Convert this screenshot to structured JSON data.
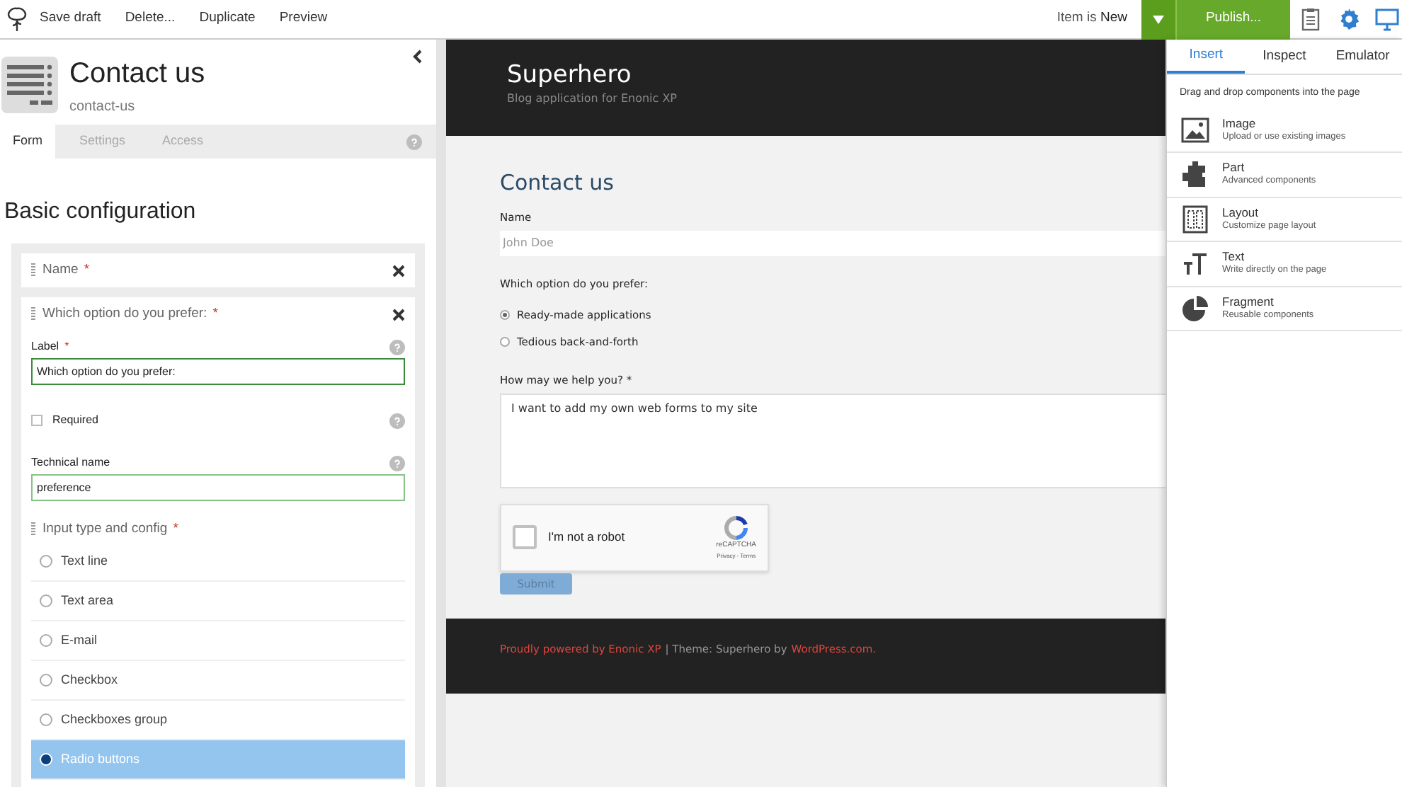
{
  "toolbar": {
    "actions": [
      "Save draft",
      "Delete...",
      "Duplicate",
      "Preview"
    ],
    "status_prefix": "Item is",
    "status": "New",
    "publish": "Publish..."
  },
  "editor": {
    "title": "Contact us",
    "path": "contact-us",
    "tabs": [
      {
        "label": "Form",
        "selected": true
      },
      {
        "label": "Settings",
        "selected": false
      },
      {
        "label": "Access",
        "selected": false
      }
    ],
    "section_title": "Basic configuration",
    "items": [
      {
        "title": "Name",
        "required": "*",
        "expanded": false
      },
      {
        "title": "Which option do you prefer:",
        "required": "*",
        "expanded": true,
        "label_field": {
          "label": "Label",
          "required": "*",
          "value": "Which option do you prefer:"
        },
        "required_option": {
          "label": "Required",
          "checked": false
        },
        "technical_field": {
          "label": "Technical name",
          "value": "preference"
        },
        "input_type": {
          "title": "Input type and config",
          "required": "*",
          "options": [
            {
              "label": "Text line",
              "selected": false
            },
            {
              "label": "Text area",
              "selected": false
            },
            {
              "label": "E-mail",
              "selected": false
            },
            {
              "label": "Checkbox",
              "selected": false
            },
            {
              "label": "Checkboxes group",
              "selected": false
            },
            {
              "label": "Radio buttons",
              "selected": true
            }
          ]
        }
      }
    ]
  },
  "preview": {
    "site_title": "Superhero",
    "tagline": "Blog application for Enonic XP",
    "form": {
      "title": "Contact us",
      "name_label": "Name",
      "name_placeholder": "John Doe",
      "question": "Which option do you prefer:",
      "options": [
        {
          "label": "Ready-made applications",
          "selected": true
        },
        {
          "label": "Tedious back-and-forth",
          "selected": false
        }
      ],
      "help_label": "How may we help you? *",
      "help_value": "I want to add my own web forms to my site",
      "captcha": {
        "label": "I'm not a robot",
        "checked": false,
        "brand": "reCAPTCHA",
        "links": "Privacy - Terms"
      },
      "submit": "Submit"
    },
    "footer": [
      {
        "text": "Proudly powered by Enonic XP",
        "kind": "link"
      },
      {
        "text": "| Theme: Superhero by",
        "kind": "text"
      },
      {
        "text": "WordPress.com.",
        "kind": "link"
      }
    ]
  },
  "panel": {
    "tabs": [
      {
        "label": "Insert",
        "selected": true
      },
      {
        "label": "Inspect",
        "selected": false
      },
      {
        "label": "Emulator",
        "selected": false
      }
    ],
    "hint": "Drag and drop components into the page",
    "components": [
      {
        "kind": "image",
        "title": "Image",
        "subtitle": "Upload or use existing images"
      },
      {
        "kind": "part",
        "title": "Part",
        "subtitle": "Advanced components"
      },
      {
        "kind": "layout",
        "title": "Layout",
        "subtitle": "Customize page layout"
      },
      {
        "kind": "text",
        "title": "Text",
        "subtitle": "Write directly on the page"
      },
      {
        "kind": "fragment",
        "title": "Fragment",
        "subtitle": "Reusable components"
      }
    ]
  }
}
